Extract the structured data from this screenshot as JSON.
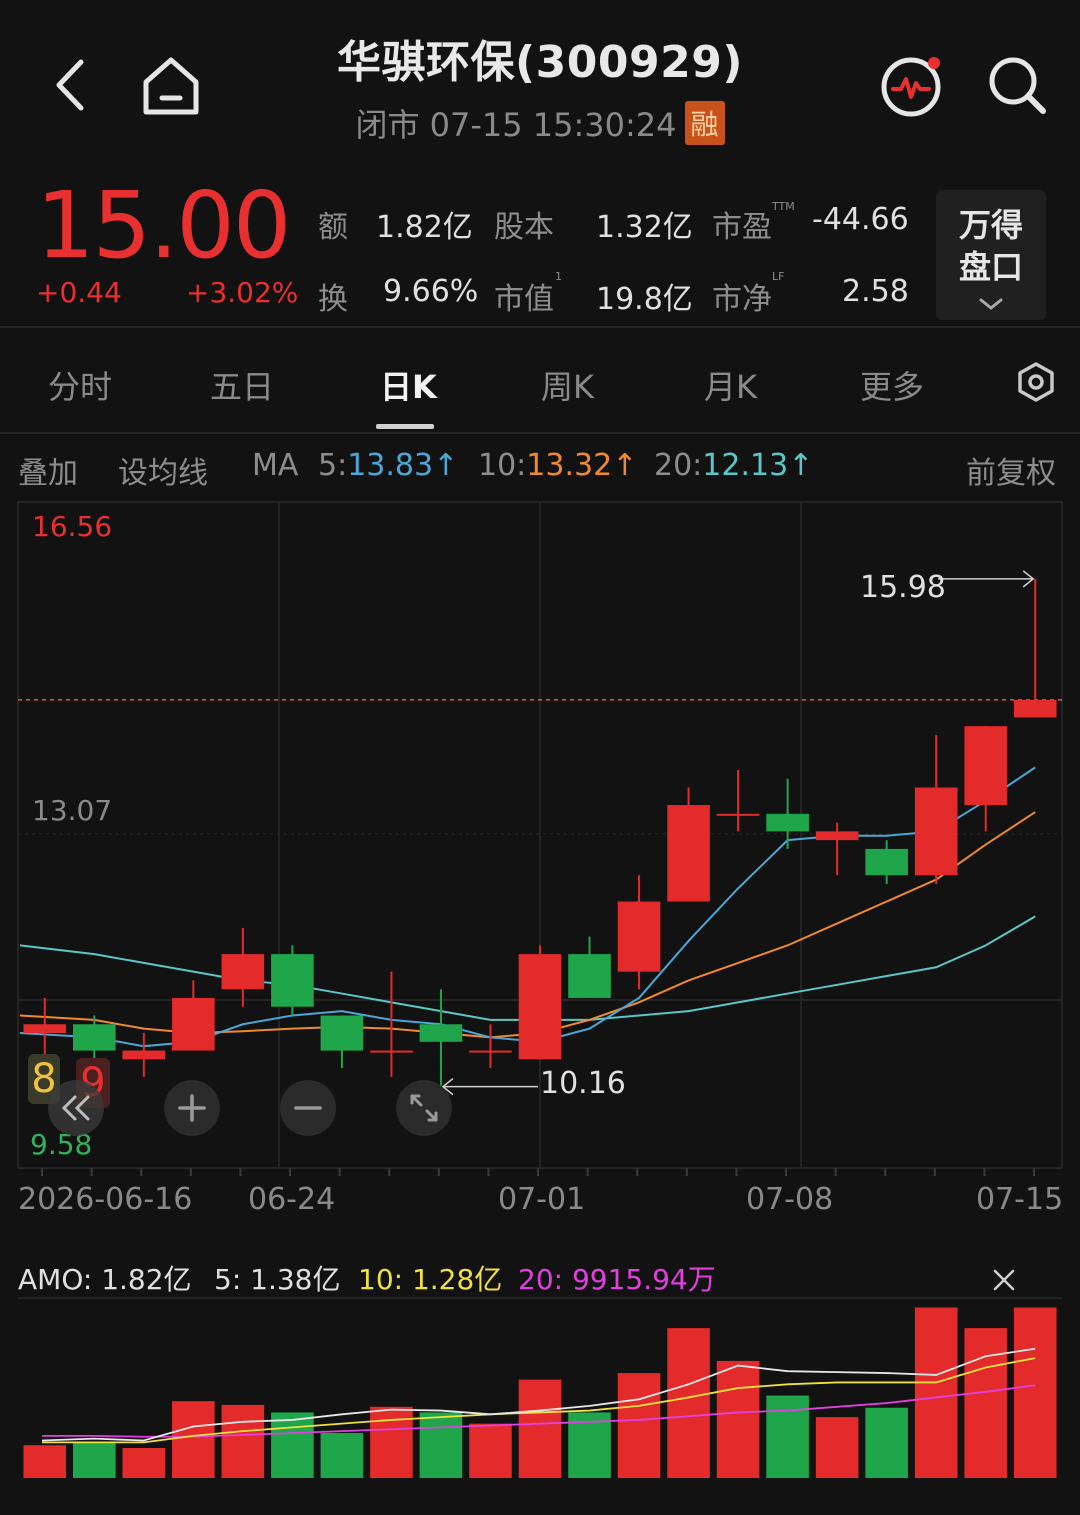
{
  "header": {
    "title": "华骐环保(300929)",
    "status": "闭市 07-15 15:30:24",
    "margin_badge": "融"
  },
  "quote": {
    "price": "15.00",
    "change": "+0.44",
    "change_pct": "+3.02%",
    "fields": [
      {
        "label": "额",
        "value": "1.82亿"
      },
      {
        "label": "股本",
        "value": "1.32亿"
      },
      {
        "label": "市盈",
        "sup": "TTM",
        "value": "-44.66"
      },
      {
        "label": "换",
        "value": "9.66%"
      },
      {
        "label": "市值",
        "sup": "1",
        "value": "19.8亿"
      },
      {
        "label": "市净",
        "sup": "LF",
        "value": "2.58"
      }
    ],
    "wande_button": [
      "万得",
      "盘口"
    ]
  },
  "tabs": [
    {
      "label": "分时",
      "active": false
    },
    {
      "label": "五日",
      "active": false
    },
    {
      "label": "日K",
      "active": true
    },
    {
      "label": "周K",
      "active": false
    },
    {
      "label": "月K",
      "active": false
    },
    {
      "label": "更多",
      "active": false
    }
  ],
  "ma_bar": {
    "overlay": "叠加",
    "set_ma": "设均线",
    "ma_label": "MA",
    "ma5_key": "5:",
    "ma5_val": "13.83↑",
    "ma10_key": "10:",
    "ma10_val": "13.32↑",
    "ma20_key": "20:",
    "ma20_val": "12.13↑",
    "adjust": "前复权"
  },
  "price_axis": {
    "top": "16.56",
    "mid": "13.07",
    "bottom": "9.58"
  },
  "annotations": {
    "high": "15.98",
    "low": "10.16"
  },
  "date_axis": [
    "2026-06-16",
    "06-24",
    "07-01",
    "07-08",
    "07-15"
  ],
  "chart_controls": {
    "badge_a": "8",
    "badge_b": "9"
  },
  "amo": {
    "label": "AMO:",
    "value": "1.82亿",
    "ma5": "5: 1.38亿",
    "ma10": "10: 1.28亿",
    "ma20": "20: 9915.94万"
  },
  "colors": {
    "up": "#e42b2b",
    "down": "#1fa64a",
    "ma5": "#4aa7d6",
    "ma10": "#f08a2c",
    "ma20": "#5cc6c8"
  },
  "chart_data": {
    "type": "candlestick",
    "ylim": [
      9.58,
      16.56
    ],
    "candles": [
      {
        "o": 10.8,
        "c": 10.9,
        "h": 11.2,
        "l": 10.4
      },
      {
        "o": 10.9,
        "c": 10.6,
        "h": 11.0,
        "l": 10.5
      },
      {
        "o": 10.5,
        "c": 10.6,
        "h": 10.8,
        "l": 10.3
      },
      {
        "o": 10.6,
        "c": 11.2,
        "h": 11.4,
        "l": 10.6
      },
      {
        "o": 11.3,
        "c": 11.7,
        "h": 12.0,
        "l": 11.1
      },
      {
        "o": 11.7,
        "c": 11.1,
        "h": 11.8,
        "l": 11.0
      },
      {
        "o": 11.0,
        "c": 10.6,
        "h": 11.0,
        "l": 10.4
      },
      {
        "o": 10.6,
        "c": 10.6,
        "h": 11.5,
        "l": 10.3
      },
      {
        "o": 10.9,
        "c": 10.7,
        "h": 11.3,
        "l": 10.2
      },
      {
        "o": 10.6,
        "c": 10.6,
        "h": 10.9,
        "l": 10.4
      },
      {
        "o": 10.5,
        "c": 11.7,
        "h": 11.8,
        "l": 10.5
      },
      {
        "o": 11.7,
        "c": 11.2,
        "h": 11.9,
        "l": 11.2
      },
      {
        "o": 11.5,
        "c": 12.3,
        "h": 12.6,
        "l": 11.3
      },
      {
        "o": 12.3,
        "c": 13.4,
        "h": 13.6,
        "l": 12.3
      },
      {
        "o": 13.3,
        "c": 13.3,
        "h": 13.8,
        "l": 13.1
      },
      {
        "o": 13.3,
        "c": 13.1,
        "h": 13.7,
        "l": 12.9
      },
      {
        "o": 13.0,
        "c": 13.1,
        "h": 13.2,
        "l": 12.6
      },
      {
        "o": 12.9,
        "c": 12.6,
        "h": 13.0,
        "l": 12.5
      },
      {
        "o": 12.6,
        "c": 13.6,
        "h": 14.2,
        "l": 12.5
      },
      {
        "o": 13.4,
        "c": 14.3,
        "h": 14.3,
        "l": 13.1
      },
      {
        "o": 14.4,
        "c": 14.6,
        "h": 15.98,
        "l": 14.5
      }
    ],
    "ma5": [
      10.8,
      10.75,
      10.65,
      10.7,
      10.9,
      11.0,
      11.05,
      10.95,
      10.9,
      10.75,
      10.7,
      10.85,
      11.2,
      11.85,
      12.45,
      13.0,
      13.05,
      13.05,
      13.1,
      13.45,
      13.83
    ],
    "ma10": [
      11.0,
      10.95,
      10.85,
      10.8,
      10.82,
      10.85,
      10.87,
      10.85,
      10.8,
      10.75,
      10.8,
      10.95,
      11.15,
      11.4,
      11.6,
      11.8,
      12.05,
      12.3,
      12.55,
      12.95,
      13.32
    ],
    "ma20": [
      11.8,
      11.7,
      11.6,
      11.5,
      11.4,
      11.35,
      11.25,
      11.15,
      11.05,
      10.95,
      10.95,
      10.95,
      11.0,
      11.05,
      11.15,
      11.25,
      11.35,
      11.45,
      11.55,
      11.8,
      12.13
    ],
    "volume": [
      0.35,
      0.38,
      0.32,
      0.82,
      0.78,
      0.7,
      0.48,
      0.76,
      0.7,
      0.58,
      1.05,
      0.7,
      1.12,
      1.6,
      1.25,
      0.88,
      0.65,
      0.75,
      1.82,
      1.6,
      1.82
    ],
    "vol_ma5": [
      0.4,
      0.42,
      0.4,
      0.55,
      0.6,
      0.62,
      0.68,
      0.73,
      0.72,
      0.68,
      0.72,
      0.77,
      0.84,
      1.0,
      1.2,
      1.14,
      1.13,
      1.12,
      1.1,
      1.3,
      1.38
    ],
    "vol_ma10": [
      0.38,
      0.38,
      0.38,
      0.45,
      0.5,
      0.54,
      0.58,
      0.62,
      0.65,
      0.68,
      0.7,
      0.72,
      0.77,
      0.86,
      0.96,
      1.0,
      1.02,
      1.02,
      1.02,
      1.18,
      1.28
    ],
    "vol_ma20": [
      0.45,
      0.45,
      0.44,
      0.44,
      0.46,
      0.48,
      0.5,
      0.52,
      0.54,
      0.56,
      0.58,
      0.6,
      0.62,
      0.66,
      0.7,
      0.72,
      0.76,
      0.8,
      0.86,
      0.92,
      0.99
    ],
    "vol_ylim": [
      0,
      1.9
    ]
  }
}
